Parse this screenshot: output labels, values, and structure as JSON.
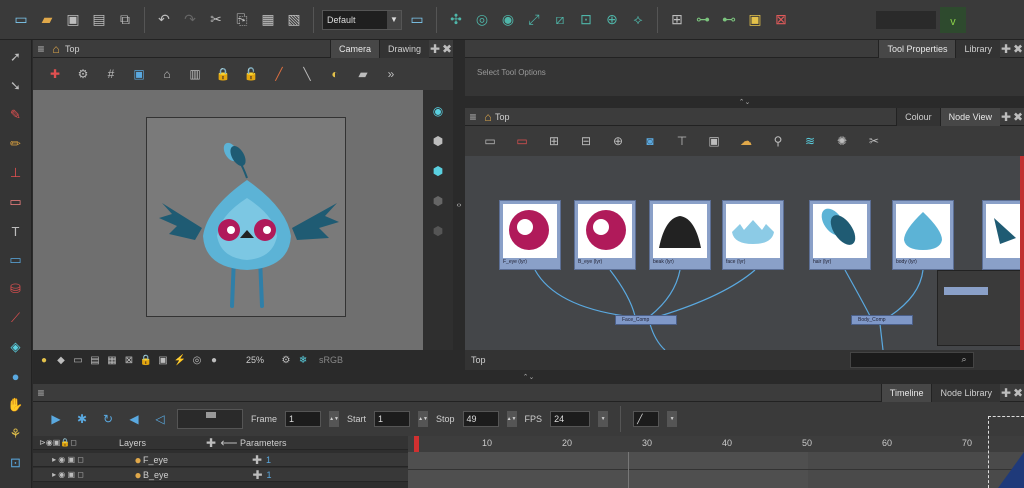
{
  "toolbar": {
    "preset": "Default",
    "icons": [
      "new-scene-icon",
      "open-icon",
      "save-icon",
      "save-as-icon",
      "import-icon",
      "undo-icon",
      "redo-icon",
      "cut-icon",
      "copy-icon",
      "paste-icon",
      "paste-special-icon",
      "workspace-icon",
      "animate-icon",
      "transform-icon",
      "rotate-icon",
      "scale-icon",
      "skew-icon",
      "maintain-size-icon",
      "pivot-icon",
      "reposition-icon",
      "reset-icon",
      "peg-icon",
      "deformer-icon",
      "select-icon"
    ]
  },
  "camera": {
    "title": "Top",
    "tabs": [
      "Camera",
      "Drawing"
    ],
    "zoom": "25%",
    "color_space": "sRGB"
  },
  "tool_properties": {
    "tabs": [
      "Tool Properties",
      "Library"
    ],
    "hint": "Select Tool Options"
  },
  "node_view": {
    "title": "Top",
    "tabs": [
      "Colour",
      "Node View"
    ],
    "status": "Top",
    "nodes": [
      "F_eye (lyr)",
      "B_eye (lyr)",
      "beak (lyr)",
      "face (lyr)",
      "hair (lyr)",
      "body (lyr)"
    ],
    "comps": [
      "Face_Comp",
      "Body_Comp"
    ]
  },
  "timeline": {
    "tabs": [
      "Timeline",
      "Node Library"
    ],
    "frame_label": "Frame",
    "frame_value": "1",
    "start_label": "Start",
    "start_value": "1",
    "stop_label": "Stop",
    "stop_value": "49",
    "fps_label": "FPS",
    "fps_value": "24",
    "layers_header": "Layers",
    "params_header": "Parameters",
    "ruler": [
      "10",
      "20",
      "30",
      "40",
      "50",
      "60",
      "70"
    ],
    "layers": [
      {
        "name": "F_eye",
        "param": "1"
      },
      {
        "name": "B_eye",
        "param": "1"
      }
    ]
  },
  "colors": {
    "node_bg": "#8aa0c8",
    "bird_blue": "#5cb3d6",
    "eye_magenta": "#b01a5a",
    "wing_dark": "#1f5b73"
  }
}
